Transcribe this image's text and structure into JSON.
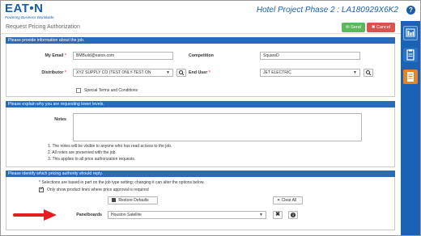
{
  "header": {
    "logo_text": "EAT•N",
    "logo_tagline": "Powering Business Worldwide",
    "project_title": "Hotel Project Phase 2 : LA180929X6K2",
    "help_glyph": "?"
  },
  "rail": {
    "icons": [
      "dashboard-icon",
      "clipboard-icon",
      "document-icon"
    ]
  },
  "subheader": {
    "title": "Request Pricing Authorization",
    "send_label": "Send",
    "cancel_label": "Cancel"
  },
  "job_panel": {
    "heading": "Please provide information about the job.",
    "my_email_label": "My Email",
    "my_email_value": "BMBuild@eaton.com",
    "competition_label": "Competition",
    "competition_value": "SquareD",
    "distributor_label": "Distributor",
    "distributor_value": "XYZ SUPPLY CO (TEST ONLY-TEST ON",
    "end_user_label": "End User",
    "end_user_value": "JET ELECTRIC",
    "special_terms_label": "Special Terms and Conditions",
    "required_marker": "*"
  },
  "explain_panel": {
    "heading": "Please explain why you are requesting lower levels.",
    "notes_label": "Notes",
    "notes_list": [
      "1.   The notes will be visible to anyone who has read access to the job.",
      "2.   All notes are preserved with the job.",
      "3.   This applies to all price authorization requests."
    ]
  },
  "authority_panel": {
    "heading": "Please identify which pricing authority should reply.",
    "selection_note": "* Selections are based in part on the job type setting; changing it can alter the options below.",
    "only_show_label": "Only show product lines where price approval is required",
    "restore_label": "Restore Defaults",
    "clear_all_label": "Clear All",
    "panelboards_label": "Panelboards",
    "panelboards_value": "Houston Satellite"
  },
  "colors": {
    "brand_blue": "#1b5ea8",
    "panel_blue": "#2a6ab6",
    "send_green": "#5cb85c",
    "cancel_red": "#d9534f",
    "arrow_red": "#e02020",
    "rail_orange": "#e58424"
  }
}
